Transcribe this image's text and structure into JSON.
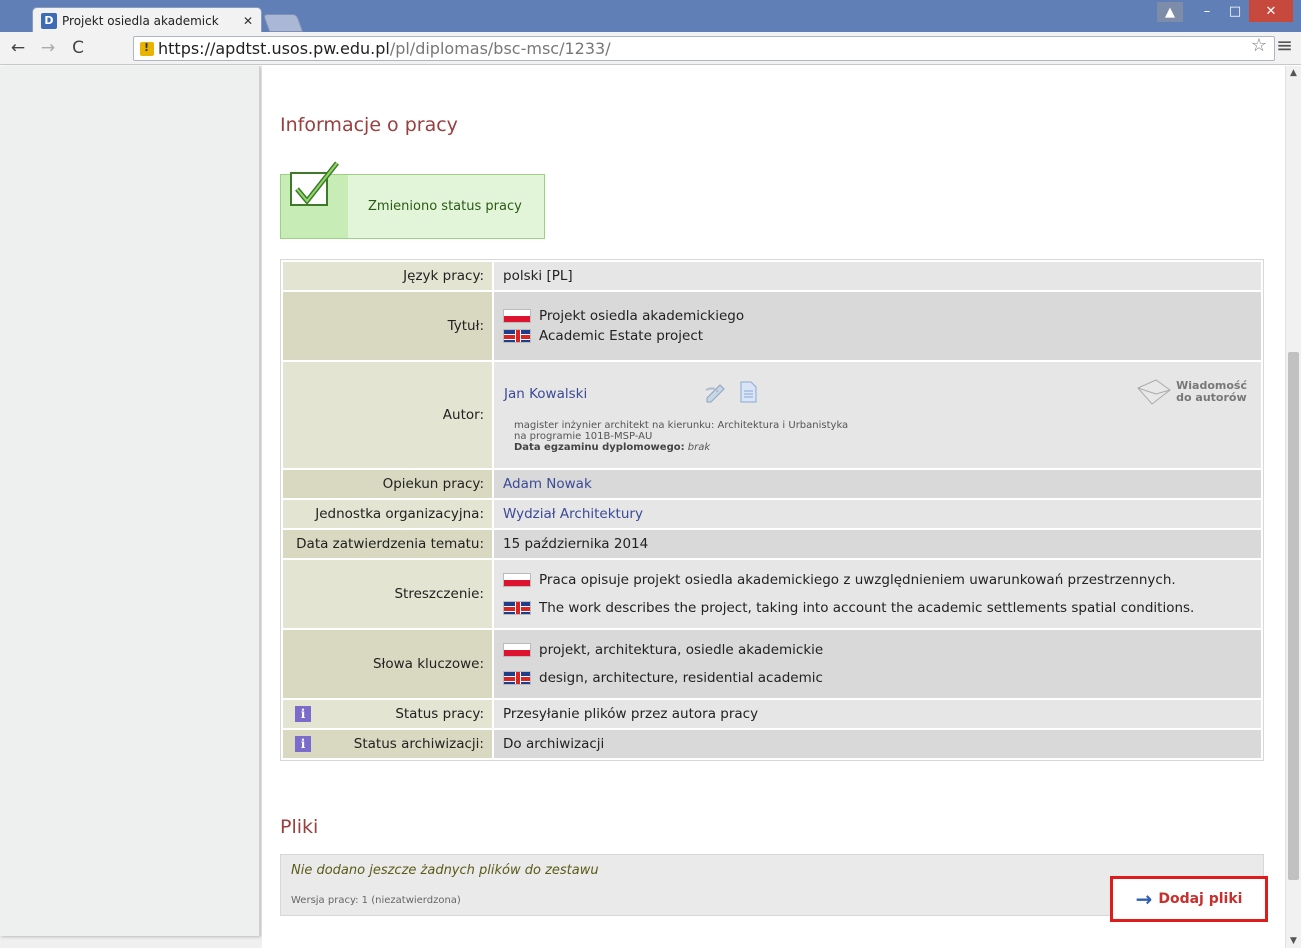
{
  "browser": {
    "tab_title": "Projekt osiedla akademick",
    "tab_favicon_letter": "D",
    "url_host": "https://apdtst.usos.pw.edu.pl",
    "url_path": "/pl/diplomas/bsc-msc/1233/"
  },
  "page": {
    "heading": "Informacje o pracy",
    "status_message": "Zmieniono status pracy",
    "files_heading": "Pliki"
  },
  "details": {
    "language_label": "Język pracy:",
    "language_value": "polski [PL]",
    "title_label": "Tytuł:",
    "title_pl": "Projekt osiedla akademickiego",
    "title_en": "Academic Estate project",
    "author_label": "Autor:",
    "author_name": "Jan Kowalski",
    "author_degree": "magister inżynier architekt na kierunku: Architektura i Urbanistyka",
    "author_program": "na programie 101B-MSP-AU",
    "exam_date_label": "Data egzaminu dyplomowego:",
    "exam_date_value": "brak",
    "message_authors_line1": "Wiadomość",
    "message_authors_line2": "do autorów",
    "supervisor_label": "Opiekun pracy:",
    "supervisor_value": "Adam Nowak",
    "unit_label": "Jednostka organizacyjna:",
    "unit_value": "Wydział Architektury",
    "approval_date_label": "Data zatwierdzenia tematu:",
    "approval_date_value": "15 października 2014",
    "abstract_label": "Streszczenie:",
    "abstract_pl": "Praca opisuje projekt osiedla akademickiego z uwzględnieniem uwarunkowań przestrzennych.",
    "abstract_en": "The work describes the project, taking into account the academic settlements spatial conditions.",
    "keywords_label": "Słowa kluczowe:",
    "keywords_pl": "projekt, architektura, osiedle akademickie",
    "keywords_en": "design, architecture, residential academic",
    "status_label": "Status pracy:",
    "status_value": "Przesyłanie plików przez autora pracy",
    "archive_status_label": "Status archiwizacji:",
    "archive_status_value": "Do archiwizacji",
    "info_icon_glyph": "i"
  },
  "files": {
    "empty_message": "Nie dodano jeszcze żadnych plików do zestawu",
    "version": "Wersja pracy: 1 (niezatwierdzona)",
    "add_button": "Dodaj pliki"
  }
}
